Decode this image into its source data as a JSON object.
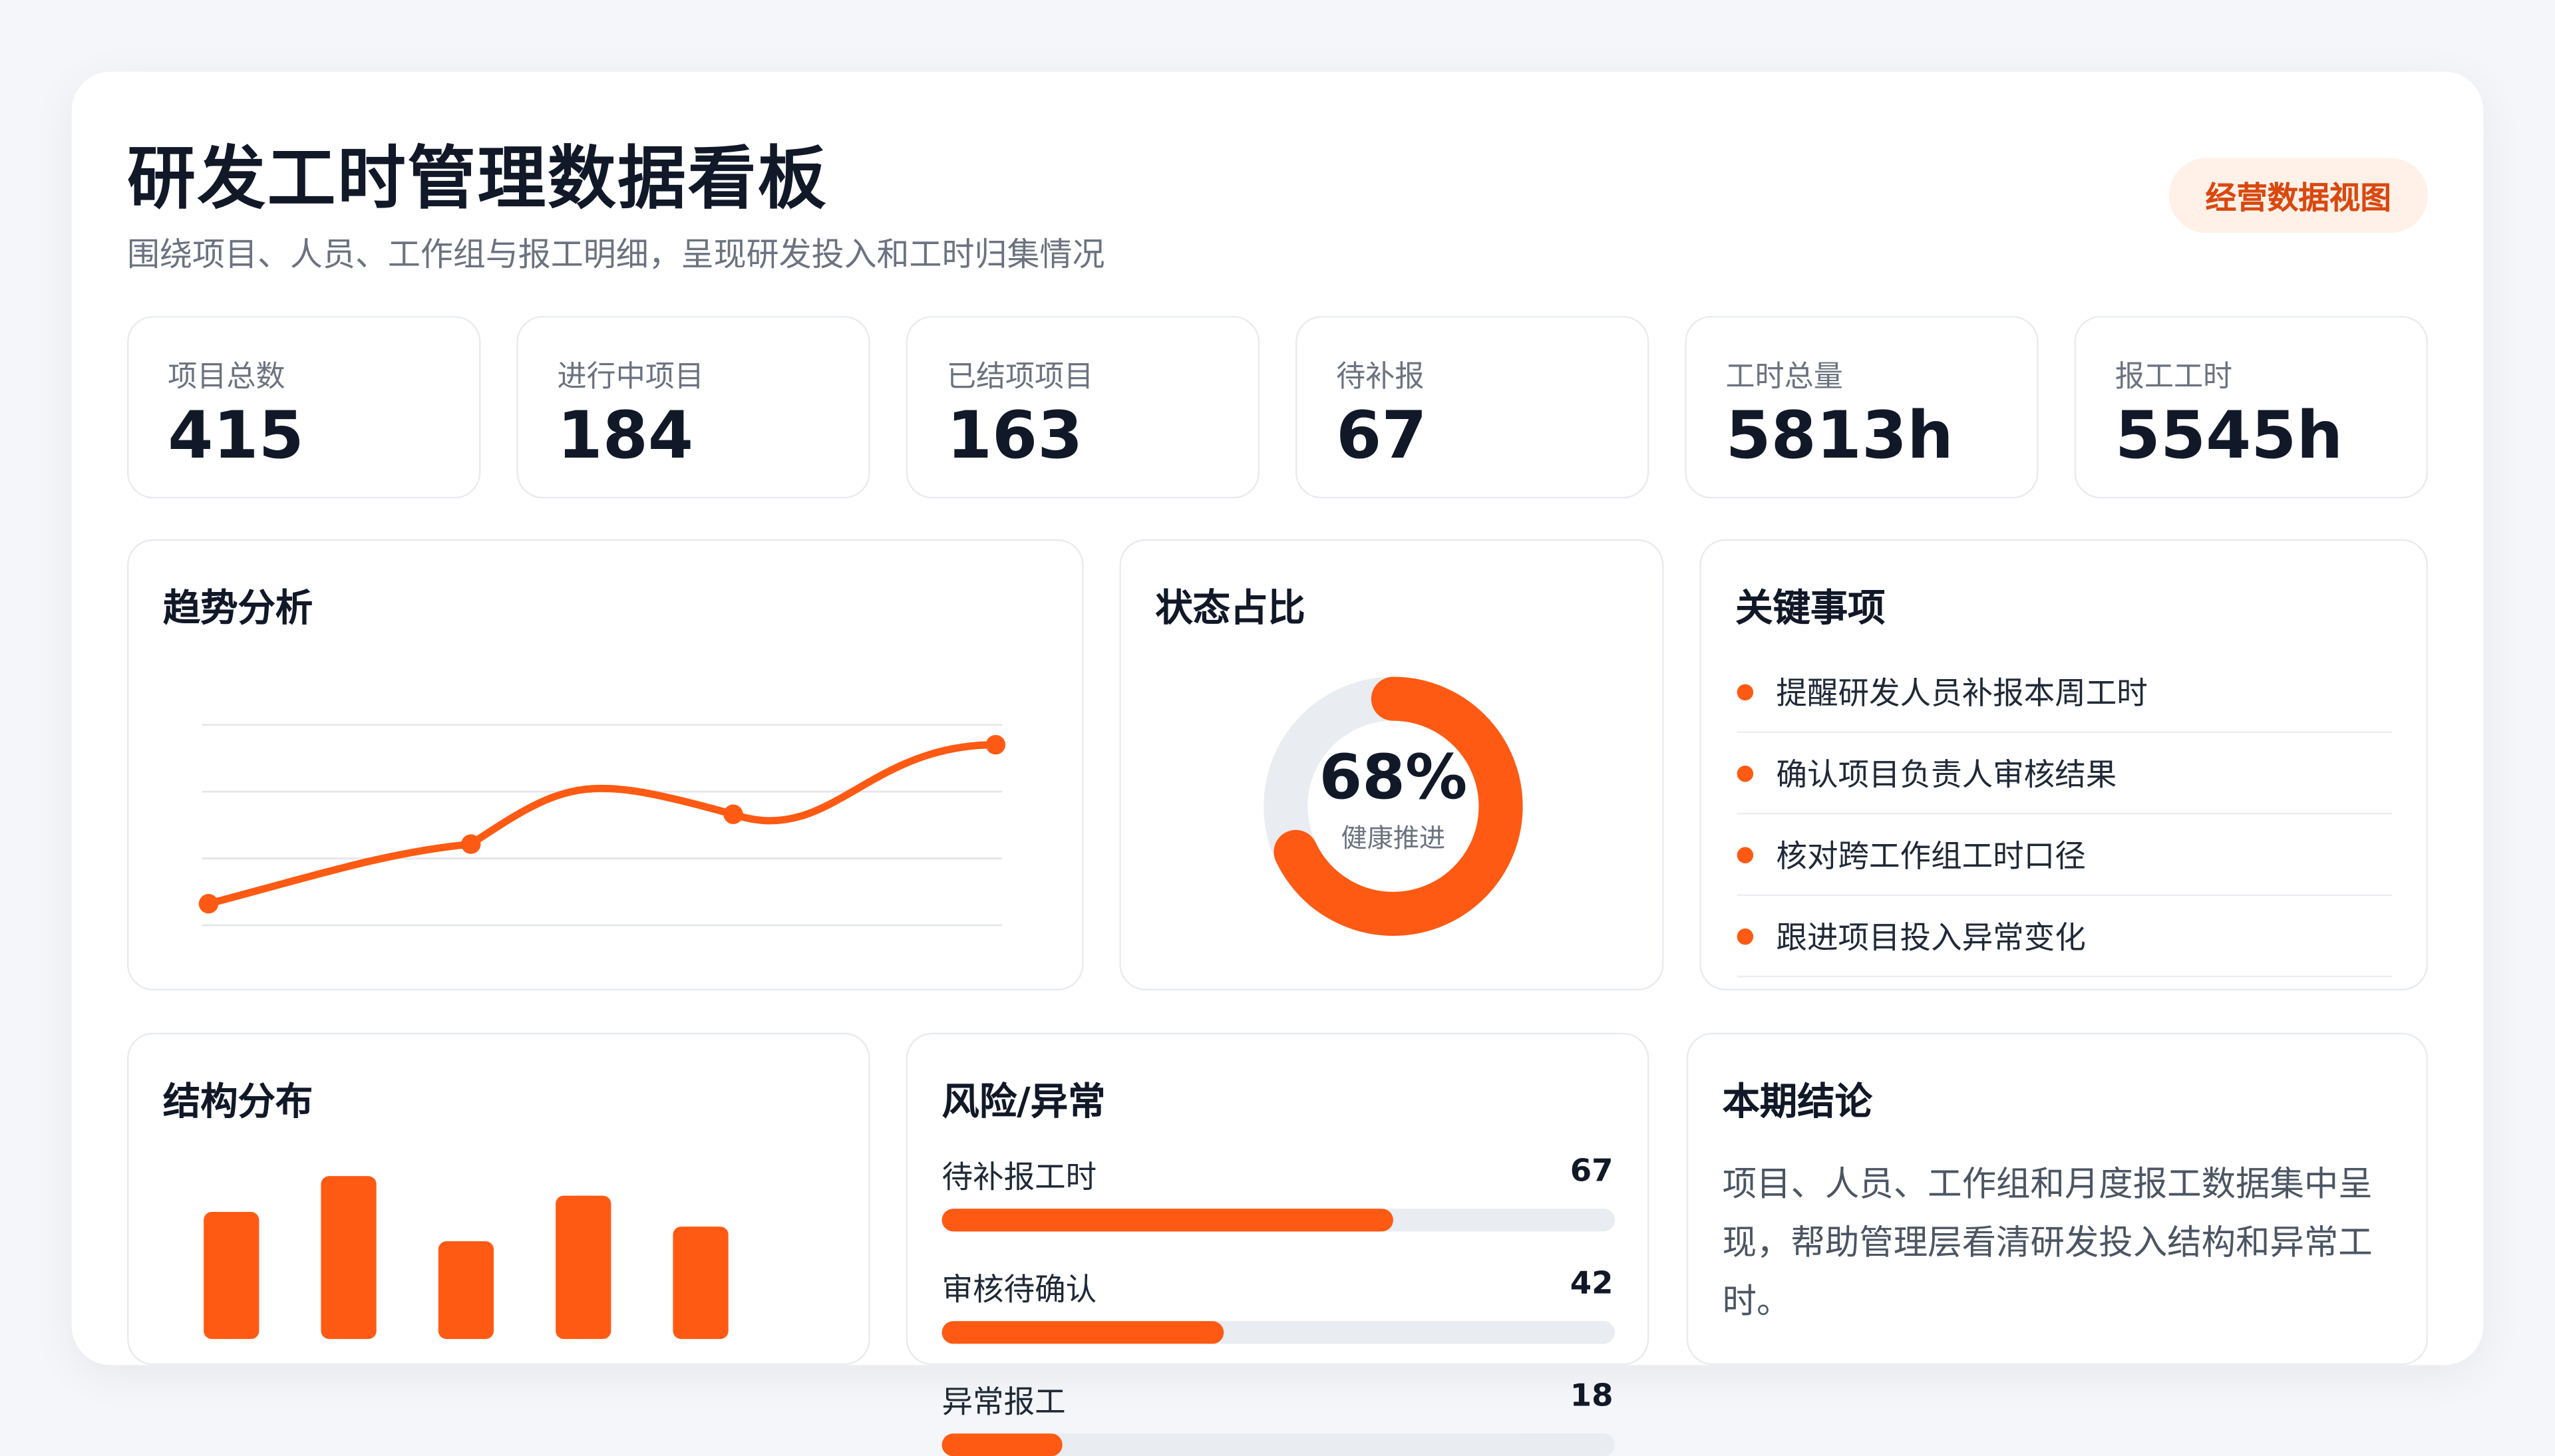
{
  "header": {
    "title": "研发工时管理数据看板",
    "subtitle": "围绕项目、人员、工作组与报工明细，呈现研发投入和工时归集情况",
    "badge": "经营数据视图"
  },
  "kpis": [
    {
      "label": "项目总数",
      "value": "415"
    },
    {
      "label": "进行中项目",
      "value": "184"
    },
    {
      "label": "已结项项目",
      "value": "163"
    },
    {
      "label": "待补报",
      "value": "67"
    },
    {
      "label": "工时总量",
      "value": "5813h"
    },
    {
      "label": "报工工时",
      "value": "5545h"
    }
  ],
  "trend": {
    "title": "趋势分析",
    "chart_data": {
      "type": "line",
      "x": [
        0,
        1,
        2,
        3
      ],
      "values": [
        0.1,
        0.4,
        0.55,
        0.9
      ],
      "ylim": [
        0,
        1
      ],
      "grid": true,
      "color": "#ff5a13"
    }
  },
  "status": {
    "title": "状态占比",
    "percent_text": "68%",
    "caption": "健康推进",
    "chart_data": {
      "type": "pie",
      "values": [
        68,
        32
      ],
      "colors": [
        "#ff5a13",
        "#e9ecf1"
      ]
    }
  },
  "key_items": {
    "title": "关键事项",
    "items": [
      "提醒研发人员补报本周工时",
      "确认项目负责人审核结果",
      "核对跨工作组工时口径",
      "跟进项目投入异常变化"
    ]
  },
  "structure": {
    "title": "结构分布",
    "chart_data": {
      "type": "bar",
      "values": [
        78,
        100,
        60,
        88,
        69
      ],
      "ylim": [
        0,
        100
      ],
      "color": "#ff5a13"
    }
  },
  "risk": {
    "title": "风险/异常",
    "items": [
      {
        "label": "待补报工时",
        "count": "67",
        "ratio": 0.67
      },
      {
        "label": "审核待确认",
        "count": "42",
        "ratio": 0.42
      },
      {
        "label": "异常报工",
        "count": "18",
        "ratio": 0.18
      }
    ]
  },
  "conclusion": {
    "title": "本期结论",
    "text": "项目、人员、工作组和月度报工数据集中呈现，帮助管理层看清研发投入结构和异常工时。"
  },
  "colors": {
    "accent": "#ff5a13",
    "badge_bg": "#fff1e8",
    "badge_text": "#d9480f",
    "track": "#e9ecf1"
  }
}
